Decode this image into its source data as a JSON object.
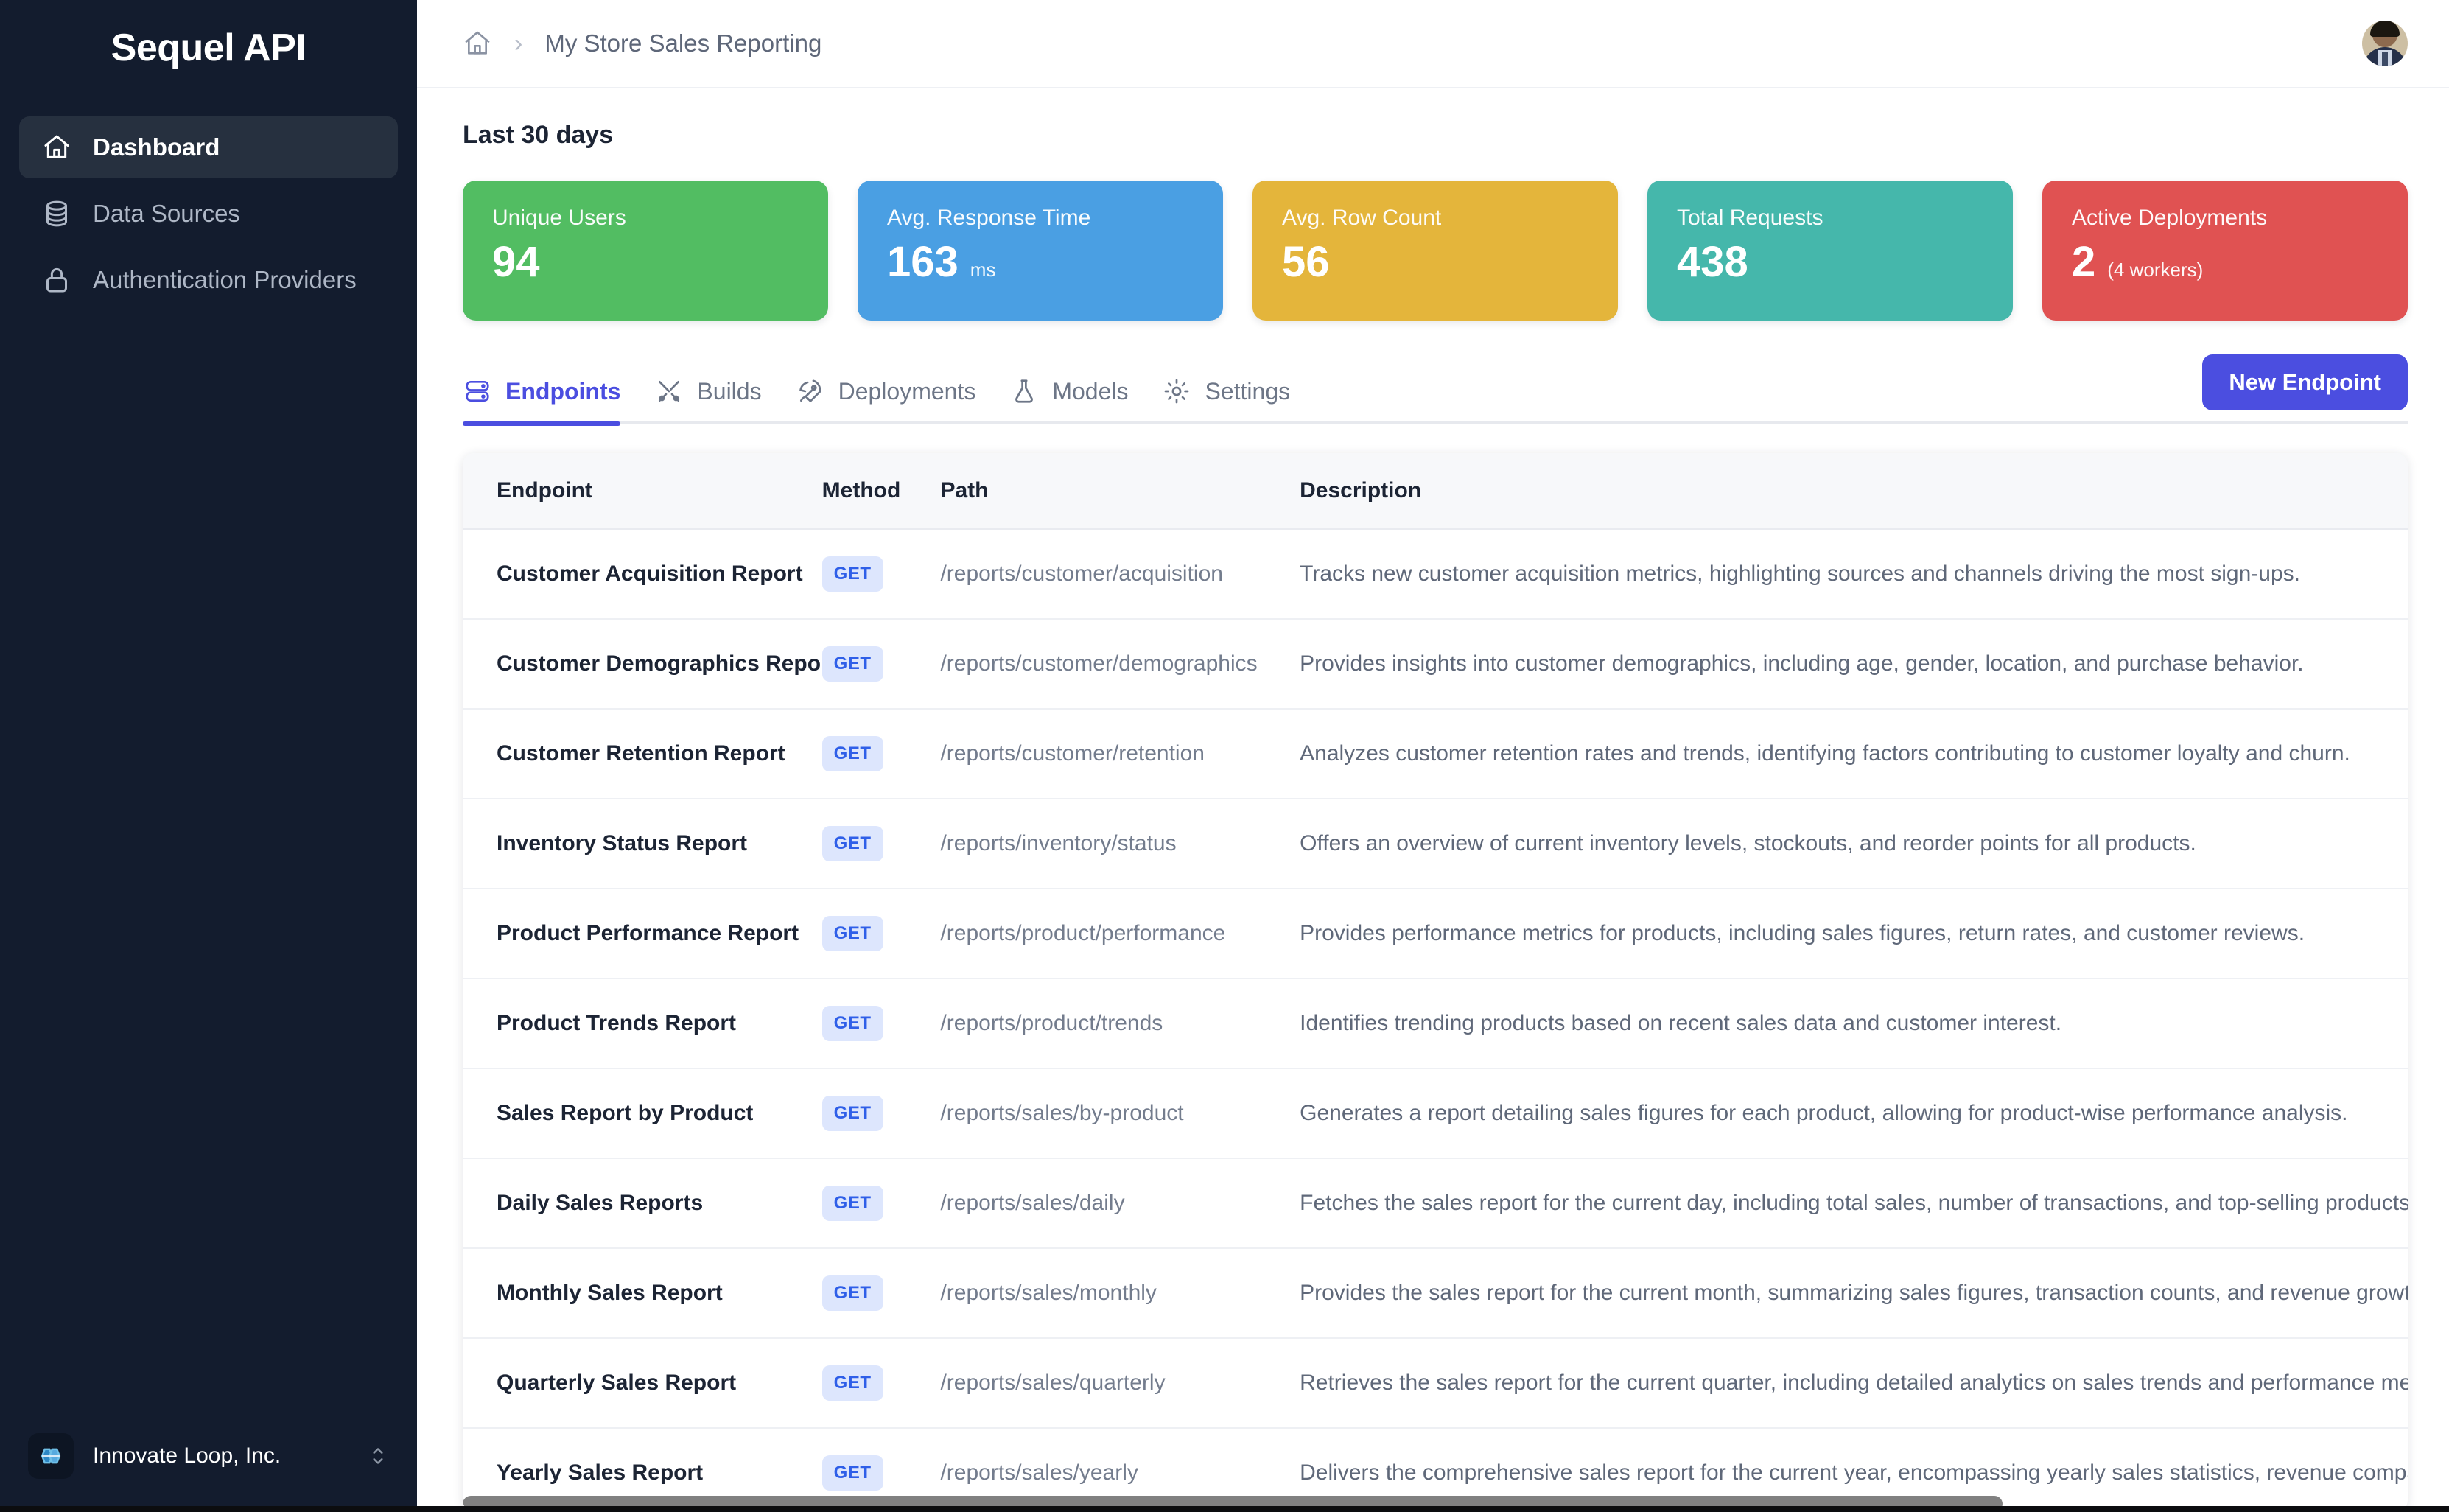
{
  "sidebar": {
    "brand": "Sequel API",
    "items": [
      {
        "label": "Dashboard",
        "icon": "home-icon",
        "active": true
      },
      {
        "label": "Data Sources",
        "icon": "database-icon",
        "active": false
      },
      {
        "label": "Authentication Providers",
        "icon": "lock-icon",
        "active": false
      }
    ],
    "org": {
      "name": "Innovate Loop, Inc.",
      "logo_icon": "infinity-loop-logo",
      "switcher_icon": "chevron-up-down-icon"
    }
  },
  "topbar": {
    "breadcrumb": {
      "home_icon": "home-icon",
      "separator": "›",
      "title": "My Store Sales Reporting"
    },
    "avatar_alt": "user-avatar"
  },
  "main": {
    "period_label": "Last 30 days",
    "stats": [
      {
        "label": "Unique Users",
        "value": "94",
        "unit": "",
        "color": "#52bd62"
      },
      {
        "label": "Avg. Response Time",
        "value": "163",
        "unit": "ms",
        "color": "#4a9fe3"
      },
      {
        "label": "Avg. Row Count",
        "value": "56",
        "unit": "",
        "color": "#e4b53b"
      },
      {
        "label": "Total Requests",
        "value": "438",
        "unit": "",
        "color": "#45b7ab"
      },
      {
        "label": "Active Deployments",
        "value": "2",
        "unit": "(4 workers)",
        "color": "#e05252"
      }
    ],
    "tabs": [
      {
        "label": "Endpoints",
        "icon": "server-stack-icon",
        "active": true
      },
      {
        "label": "Builds",
        "icon": "tools-icon",
        "active": false
      },
      {
        "label": "Deployments",
        "icon": "rocket-icon",
        "active": false
      },
      {
        "label": "Models",
        "icon": "flask-icon",
        "active": false
      },
      {
        "label": "Settings",
        "icon": "gear-icon",
        "active": false
      }
    ],
    "new_endpoint_label": "New Endpoint",
    "table": {
      "columns": [
        "Endpoint",
        "Method",
        "Path",
        "Description"
      ],
      "rows": [
        {
          "endpoint": "Customer Acquisition Report",
          "method": "GET",
          "path": "/reports/customer/acquisition",
          "description": "Tracks new customer acquisition metrics, highlighting sources and channels driving the most sign-ups."
        },
        {
          "endpoint": "Customer Demographics Report",
          "method": "GET",
          "path": "/reports/customer/demographics",
          "description": "Provides insights into customer demographics, including age, gender, location, and purchase behavior."
        },
        {
          "endpoint": "Customer Retention Report",
          "method": "GET",
          "path": "/reports/customer/retention",
          "description": "Analyzes customer retention rates and trends, identifying factors contributing to customer loyalty and churn."
        },
        {
          "endpoint": "Inventory Status Report",
          "method": "GET",
          "path": "/reports/inventory/status",
          "description": "Offers an overview of current inventory levels, stockouts, and reorder points for all products."
        },
        {
          "endpoint": "Product Performance Report",
          "method": "GET",
          "path": "/reports/product/performance",
          "description": "Provides performance metrics for products, including sales figures, return rates, and customer reviews."
        },
        {
          "endpoint": "Product Trends Report",
          "method": "GET",
          "path": "/reports/product/trends",
          "description": "Identifies trending products based on recent sales data and customer interest."
        },
        {
          "endpoint": "Sales Report by Product",
          "method": "GET",
          "path": "/reports/sales/by-product",
          "description": "Generates a report detailing sales figures for each product, allowing for product-wise performance analysis."
        },
        {
          "endpoint": "Daily Sales Reports",
          "method": "GET",
          "path": "/reports/sales/daily",
          "description": "Fetches the sales report for the current day, including total sales, number of transactions, and top-selling products."
        },
        {
          "endpoint": "Monthly Sales Report",
          "method": "GET",
          "path": "/reports/sales/monthly",
          "description": "Provides the sales report for the current month, summarizing sales figures, transaction counts, and revenue growth."
        },
        {
          "endpoint": "Quarterly Sales Report",
          "method": "GET",
          "path": "/reports/sales/quarterly",
          "description": "Retrieves the sales report for the current quarter, including detailed analytics on sales trends and performance metrics."
        },
        {
          "endpoint": "Yearly Sales Report",
          "method": "GET",
          "path": "/reports/sales/yearly",
          "description": "Delivers the comprehensive sales report for the current year, encompassing yearly sales statistics, revenue comparisons"
        }
      ]
    }
  },
  "theme": {
    "accent": "#4b4ee0",
    "sidebar_bg": "#131c2e",
    "method_badge_bg": "#dde6fd",
    "method_badge_fg": "#2f5fe8"
  }
}
